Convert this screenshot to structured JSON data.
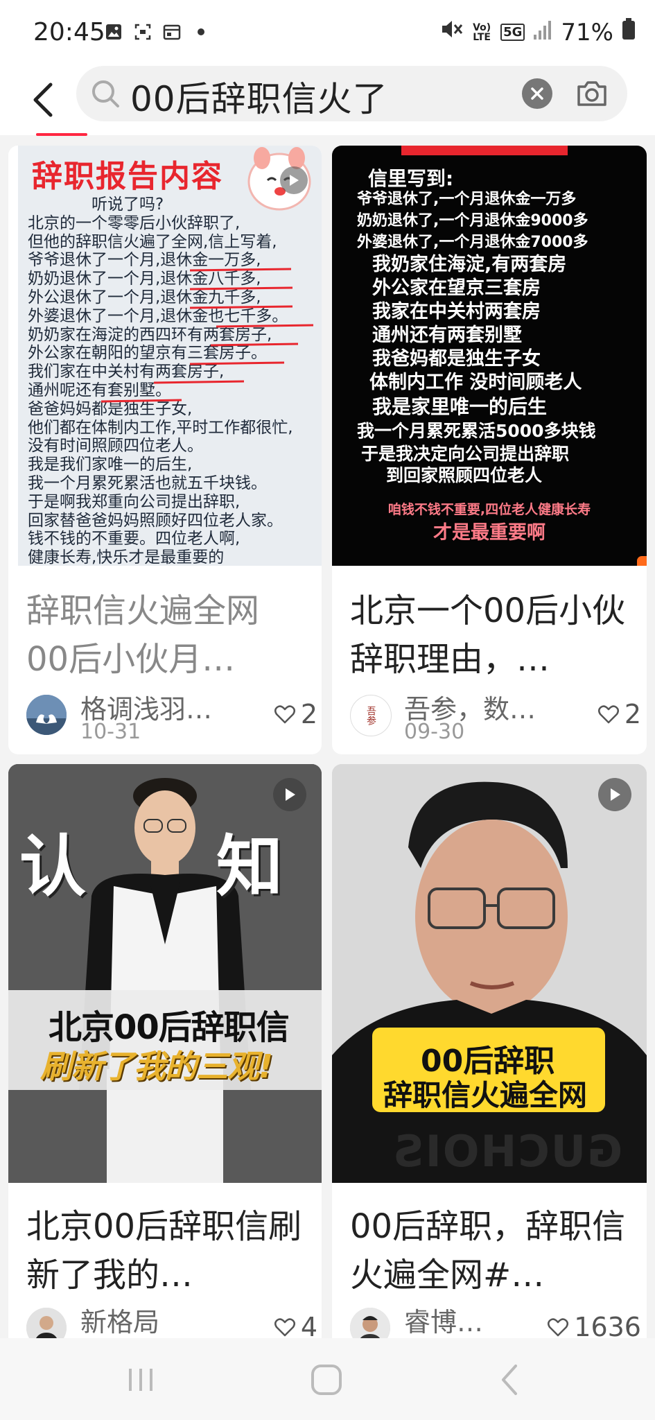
{
  "status_bar": {
    "time": "20:45",
    "battery": "71%",
    "network": "5G",
    "volte": "Vo) LTE"
  },
  "search": {
    "query": "00后辞职信火了"
  },
  "cards": [
    {
      "title": "辞职信火遍全网 00后小伙月…",
      "author": "格调浅羽…",
      "date": "10-31",
      "likes": "2",
      "image": {
        "heading": "辞职报告内容",
        "lines": [
          "听说了吗?",
          "北京的一个零零后小伙辞职了,",
          "但他的辞职信火遍了全网,信上写着,",
          "爷爷退休了一个月,退休金一万多,",
          "奶奶退休了一个月,退休金八千多,",
          "外公退休了一个月,退休金九千多,",
          "外婆退休了一个月,退休金也七千多。",
          "奶奶家在海淀的西四环有两套房子,",
          "外公家在朝阳的望京有三套房子。",
          "我们家在中关村有两套房子,",
          "通州呢还有套别墅。",
          "爸爸妈妈都是独生子女,",
          "他们都在体制内工作,平时工作都很忙,",
          "没有时间照顾四位老人。",
          "我是我们家唯一的后生,",
          "我一个月累死累活也就五千块钱。",
          "于是啊我郑重向公司提出辞职,",
          "回家替爸爸妈妈照顾好四位老人家。",
          "钱不钱的不重要。四位老人啊,",
          "健康长寿,快乐才是最重要的"
        ]
      }
    },
    {
      "title": "北京一个00后小伙辞职理由，…",
      "author": "吾参，数…",
      "date": "09-30",
      "likes": "2",
      "image": {
        "heading": "信里写到:",
        "lines": [
          "爷爷退休了,一个月退休金一万多",
          "奶奶退休了,一个月退休金9000多",
          "外婆退休了,一个月退休金7000多",
          "我奶家住海淀,有两套房",
          "外公家在望京三套房",
          "我家在中关村两套房",
          "通州还有两套别墅",
          "我爸妈都是独生子女",
          "体制内工作 没时间顾老人",
          "我是家里唯一的后生",
          "我一个月累死累活5000多块钱",
          "于是我决定向公司提出辞职",
          "到回家照顾四位老人"
        ],
        "red_lines": [
          "咱钱不钱不重要,四位老人健康长寿",
          "才是最重要啊"
        ],
        "avatar_text": "吾参"
      }
    },
    {
      "title": "北京00后辞职信刷新了我的…",
      "author": "新格局",
      "date": "",
      "likes": "4",
      "image": {
        "big_left": "认",
        "big_right": "知",
        "banner_line1": "北京00后辞职信",
        "banner_line2": "刷新了我的三观!"
      }
    },
    {
      "title": "00后辞职，辞职信火遍全网#…",
      "author": "睿博…",
      "date": "",
      "likes": "1636",
      "image": {
        "banner_line1": "00后辞职",
        "banner_line2": "辞职信火遍全网",
        "shirt_text": "GUCHOIS"
      }
    }
  ],
  "colors": {
    "accent": "#ff2741",
    "highlight_yellow": "#ffd92e",
    "text_dark": "#222222"
  },
  "icons": {
    "back": "back-arrow-icon",
    "search": "search-icon",
    "clear": "clear-icon",
    "camera": "camera-icon",
    "like": "heart-icon",
    "play": "play-icon"
  }
}
